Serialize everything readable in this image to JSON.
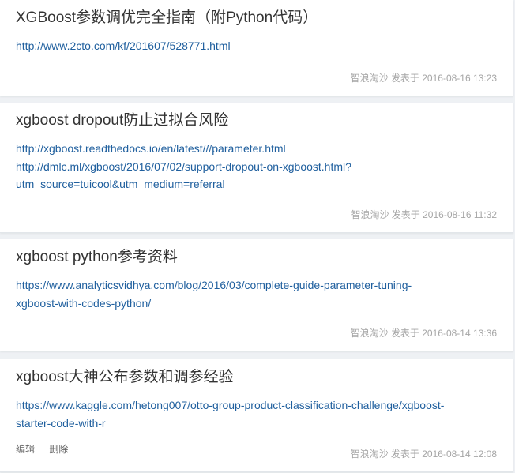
{
  "posts": [
    {
      "title": "XGBoost参数调优完全指南（附Python代码）",
      "links": [
        "http://www.2cto.com/kf/201607/528771.html"
      ],
      "meta": "智浪淘沙 发表于 2016-08-16 13:23"
    },
    {
      "title": "xgboost dropout防止过拟合风险",
      "links": [
        "http://xgboost.readthedocs.io/en/latest///parameter.html",
        "http://dmlc.ml/xgboost/2016/07/02/support-dropout-on-xgboost.html?",
        "utm_source=tuicool&utm_medium=referral"
      ],
      "meta": "智浪淘沙 发表于 2016-08-16 11:32"
    },
    {
      "title": "xgboost python参考资料",
      "links": [
        "https://www.analyticsvidhya.com/blog/2016/03/complete-guide-parameter-tuning-",
        "xgboost-with-codes-python/"
      ],
      "meta": "智浪淘沙 发表于 2016-08-14 13:36"
    },
    {
      "title": "xgboost大神公布参数和调参经验",
      "links": [
        "https://www.kaggle.com/hetong007/otto-group-product-classification-challenge/xgboost-",
        "starter-code-with-r"
      ],
      "meta": "智浪淘沙 发表于 2016-08-14 12:08",
      "actions": {
        "edit": "编辑",
        "delete": "删除"
      }
    }
  ]
}
